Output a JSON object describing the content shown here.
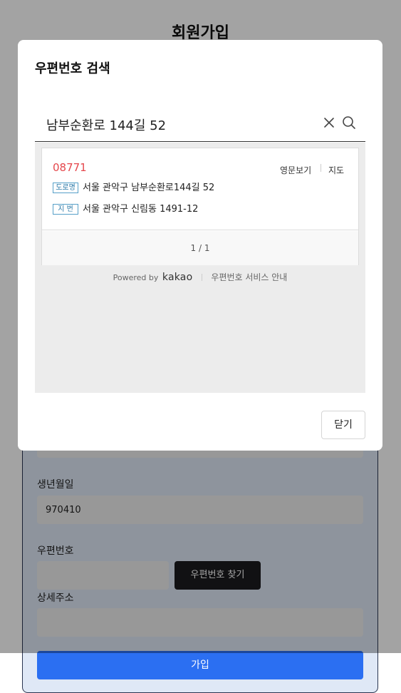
{
  "page": {
    "title": "회원가입",
    "fields": {
      "birth_label": "생년월일",
      "birth_value": "970410",
      "zip_label": "우편번호",
      "zip_value": "",
      "zip_button": "우편번호 찾기",
      "detail_label": "상세주소",
      "detail_value": "",
      "submit_label": "가입"
    }
  },
  "modal": {
    "title": "우편번호 검색",
    "search": {
      "value": "남부순환로 144길 52"
    },
    "results": [
      {
        "zipcode": "08771",
        "road_badge": "도로명",
        "road_address": "서울 관악구 남부순환로144길 52",
        "jibun_badge": "지 번",
        "jibun_address": "서울 관악구 신림동 1491-12",
        "link_english": "영문보기",
        "link_map": "지도"
      }
    ],
    "pagination": "1 / 1",
    "footer": {
      "powered_by": "Powered by",
      "brand": "kakao",
      "service_link": "우편번호 서비스 안내"
    },
    "close_label": "닫기"
  },
  "colors": {
    "accent_blue": "#2b6ff2",
    "zipcode_red": "#e5474c",
    "badge_blue": "#2a79a8",
    "dark_button": "#1c1c1e"
  }
}
